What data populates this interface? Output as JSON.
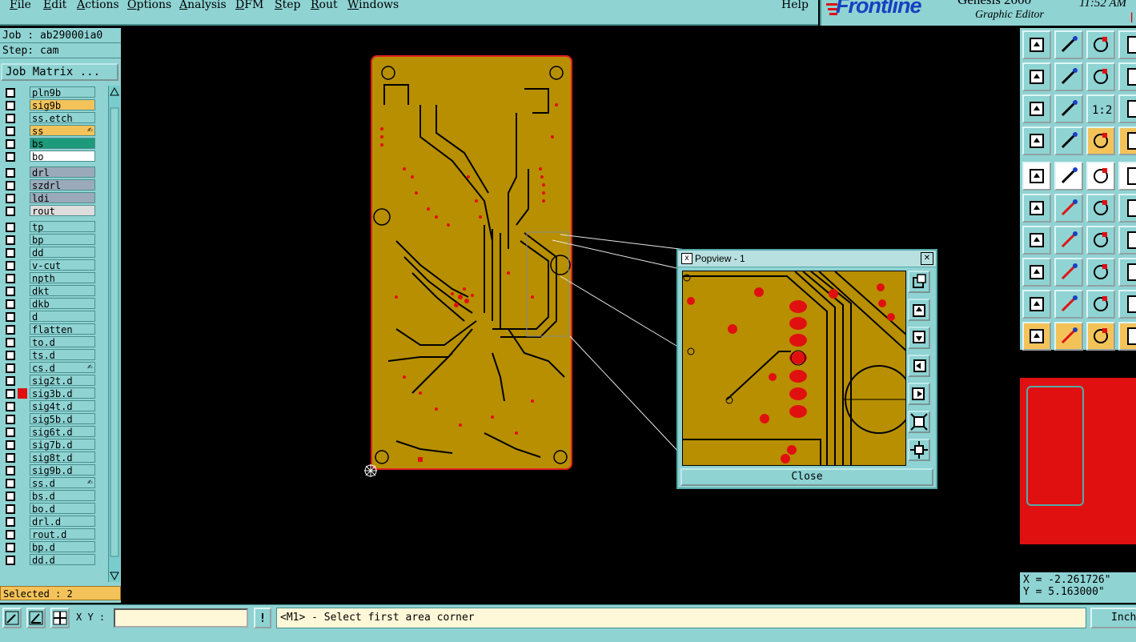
{
  "menubar": {
    "items": [
      "File",
      "Edit",
      "Actions",
      "Options",
      "Analysis",
      "DFM",
      "Step",
      "Rout",
      "Windows"
    ],
    "help": "Help"
  },
  "brand": {
    "logo": "Frontline",
    "product": "Genesis 2000",
    "subtitle": "Graphic Editor",
    "clock": "11:52 AM",
    "pause": "||"
  },
  "colors": {
    "panel": "#8fd3d3",
    "board": "#b78f00",
    "copper_pad": "#e01010",
    "highlight": "#f3c35a"
  },
  "leftpanel": {
    "job": "Job : ab29000ia0",
    "step": "Step: cam",
    "job_matrix": "Job Matrix ...",
    "layers": [
      {
        "name": "pln9b",
        "color": "#8fd3d3",
        "mark": "",
        "act": ""
      },
      {
        "name": "sig9b",
        "color": "#f3c35a",
        "mark": "",
        "act": ""
      },
      {
        "name": "ss.etch",
        "color": "#8fd3d3",
        "mark": "",
        "act": ""
      },
      {
        "name": "ss",
        "color": "#f3c35a",
        "mark": "",
        "act": "✍"
      },
      {
        "name": "bs",
        "color": "#1d9a7a",
        "mark": "",
        "act": ""
      },
      {
        "name": "bo",
        "color": "#ffffff",
        "mark": "",
        "act": ""
      },
      {
        "name": "drl",
        "color": "#9aaabb",
        "mark": "",
        "act": ""
      },
      {
        "name": "szdrl",
        "color": "#9aaabb",
        "mark": "",
        "act": ""
      },
      {
        "name": "ldi",
        "color": "#9aaabb",
        "mark": "",
        "act": ""
      },
      {
        "name": "rout",
        "color": "#dddddd",
        "mark": "",
        "act": ""
      },
      {
        "name": "tp",
        "color": "#8fd3d3",
        "mark": "",
        "act": ""
      },
      {
        "name": "bp",
        "color": "#8fd3d3",
        "mark": "",
        "act": ""
      },
      {
        "name": "dd",
        "color": "#8fd3d3",
        "mark": "",
        "act": ""
      },
      {
        "name": "v-cut",
        "color": "#8fd3d3",
        "mark": "",
        "act": ""
      },
      {
        "name": "npth",
        "color": "#8fd3d3",
        "mark": "",
        "act": ""
      },
      {
        "name": "dkt",
        "color": "#8fd3d3",
        "mark": "",
        "act": ""
      },
      {
        "name": "dkb",
        "color": "#8fd3d3",
        "mark": "",
        "act": ""
      },
      {
        "name": "d",
        "color": "#8fd3d3",
        "mark": "",
        "act": ""
      },
      {
        "name": "flatten",
        "color": "#8fd3d3",
        "mark": "",
        "act": ""
      },
      {
        "name": "to.d",
        "color": "#8fd3d3",
        "mark": "",
        "act": ""
      },
      {
        "name": "ts.d",
        "color": "#8fd3d3",
        "mark": "",
        "act": ""
      },
      {
        "name": "cs.d",
        "color": "#8fd3d3",
        "mark": "",
        "act": "✍"
      },
      {
        "name": "sig2t.d",
        "color": "#8fd3d3",
        "mark": "",
        "act": ""
      },
      {
        "name": "sig3b.d",
        "color": "#8fd3d3",
        "mark": "#e01010",
        "act": ""
      },
      {
        "name": "sig4t.d",
        "color": "#8fd3d3",
        "mark": "",
        "act": ""
      },
      {
        "name": "sig5b.d",
        "color": "#8fd3d3",
        "mark": "",
        "act": ""
      },
      {
        "name": "sig6t.d",
        "color": "#8fd3d3",
        "mark": "",
        "act": ""
      },
      {
        "name": "sig7b.d",
        "color": "#8fd3d3",
        "mark": "",
        "act": ""
      },
      {
        "name": "sig8t.d",
        "color": "#8fd3d3",
        "mark": "",
        "act": ""
      },
      {
        "name": "sig9b.d",
        "color": "#8fd3d3",
        "mark": "",
        "act": ""
      },
      {
        "name": "ss.d",
        "color": "#8fd3d3",
        "mark": "",
        "act": "✍"
      },
      {
        "name": "bs.d",
        "color": "#8fd3d3",
        "mark": "",
        "act": ""
      },
      {
        "name": "bo.d",
        "color": "#8fd3d3",
        "mark": "",
        "act": ""
      },
      {
        "name": "drl.d",
        "color": "#8fd3d3",
        "mark": "",
        "act": ""
      },
      {
        "name": "rout.d",
        "color": "#8fd3d3",
        "mark": "",
        "act": ""
      },
      {
        "name": "bp.d",
        "color": "#8fd3d3",
        "mark": "",
        "act": ""
      },
      {
        "name": "dd.d",
        "color": "#8fd3d3",
        "mark": "",
        "act": ""
      }
    ],
    "selected": "Selected : 2"
  },
  "popview": {
    "title": "Popview - 1",
    "close_label": "Close",
    "close_x": "✕"
  },
  "righttoolbar": {
    "icons": [
      "layers-icon",
      "selection-icon",
      "home-icon",
      "zoom-icon",
      "pan-left-icon",
      "pan-right-icon",
      "undo-zoom-icon",
      "zoom-window-icon",
      "fit-icon",
      "center-icon",
      "scale-1-2-icon",
      "help-icon",
      "settings-icon",
      "grid-icon",
      "snap-icon",
      "route-icon",
      "pad-icon",
      "line-icon",
      "measure-icon",
      "circle-icon",
      "net-icon",
      "cross-icon",
      "connect-icon",
      "node-icon",
      "draw-line-icon",
      "draw-slash-icon",
      "arc-icon",
      "bracket-icon",
      "pad-add-icon",
      "line-add-icon",
      "dimension-icon",
      "via-icon",
      "polygon-icon",
      "polygon-edge-icon",
      "polygon-fill-icon",
      "polygon-slash-icon",
      "pointer-icon",
      "pointer-box-icon",
      "pointer-circle-icon",
      "step-icon"
    ],
    "scale_label": "1:2"
  },
  "coords": {
    "x": "X = -2.261726\"",
    "y": "Y = 5.163000\""
  },
  "bottombar": {
    "xy_label": "X Y :",
    "xy_value": "",
    "exclaim": "!",
    "prompt": "<M1> - Select first area corner",
    "units": "Inch"
  }
}
